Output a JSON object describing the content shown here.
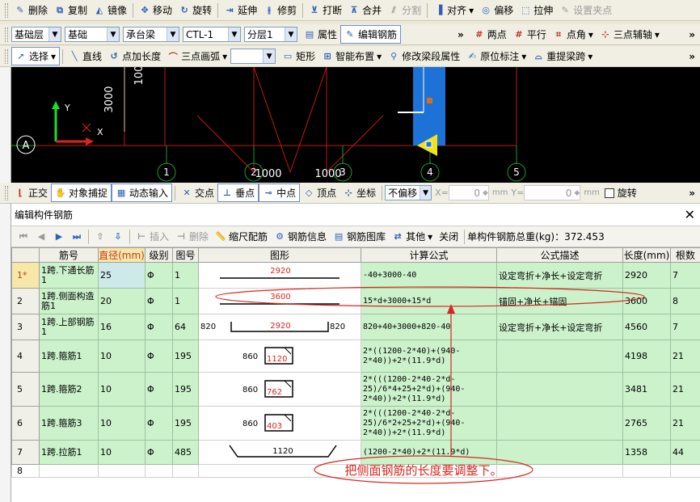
{
  "toolbar1": {
    "items": [
      {
        "label": "删除",
        "icon": "erase-icon",
        "disabled": false
      },
      {
        "label": "复制",
        "icon": "copy-icon",
        "disabled": false
      },
      {
        "label": "镜像",
        "icon": "mirror-icon",
        "disabled": false
      },
      {
        "label": "移动",
        "icon": "move-icon",
        "disabled": false
      },
      {
        "label": "旋转",
        "icon": "rotate-icon",
        "disabled": false
      },
      {
        "label": "延伸",
        "icon": "extend-icon",
        "disabled": false
      },
      {
        "label": "修剪",
        "icon": "trim-icon",
        "disabled": false
      },
      {
        "label": "打断",
        "icon": "break-icon",
        "disabled": false
      },
      {
        "label": "合并",
        "icon": "merge-icon",
        "disabled": false
      },
      {
        "label": "分割",
        "icon": "split-icon",
        "disabled": true
      },
      {
        "label": "对齐",
        "icon": "align-icon",
        "disabled": false
      },
      {
        "label": "偏移",
        "icon": "offset-icon",
        "disabled": false
      },
      {
        "label": "拉伸",
        "icon": "stretch-icon",
        "disabled": false
      },
      {
        "label": "设置夹点",
        "icon": "grip-point-icon",
        "disabled": true
      }
    ]
  },
  "toolbar2": {
    "floor": "基础层",
    "category": "基础",
    "type": "承台梁",
    "element": "CTL-1",
    "layer": "分层1",
    "props_label": "属性",
    "edit_rebar_label": "编辑钢筋",
    "right": [
      "两点",
      "平行",
      "点角",
      "三点辅轴"
    ]
  },
  "toolbar3": {
    "select_label": "选择",
    "items": [
      "直线",
      "点加长度",
      "三点画弧",
      "矩形",
      "智能布置",
      "修改梁段属性",
      "原位标注",
      "重提梁跨"
    ]
  },
  "cad": {
    "axis_label_a": "A",
    "dim_3000": "3000",
    "dim_100": "100",
    "dim_1000a": "1000",
    "dim_1000b": "1000",
    "grid_labels": [
      "1",
      "2",
      "3",
      "4",
      "5"
    ],
    "axis_y": "Y",
    "axis_x": "X"
  },
  "snapbar": {
    "items": [
      "正交",
      "对象捕捉",
      "动态输入",
      "交点",
      "垂点",
      "中点",
      "顶点",
      "坐标"
    ],
    "offset_mode": "不偏移",
    "x_label": "X=",
    "x_value": "0",
    "y_label": "Y=",
    "y_value": "0",
    "unit": "mm",
    "rotate_label": "旋转"
  },
  "panel": {
    "title": "编辑构件钢筋",
    "tools": [
      "插入",
      "删除",
      "缩尺配筋",
      "钢筋信息",
      "钢筋图库",
      "其他",
      "关闭"
    ],
    "total_label": "单构件钢筋总重(kg)：",
    "total_value": "372.453"
  },
  "table": {
    "headers": [
      "筋号",
      "直径(mm)",
      "级别",
      "图号",
      "图形",
      "计算公式",
      "公式描述",
      "长度(mm)",
      "根数"
    ],
    "rows": [
      {
        "num": "1*",
        "name": "1跨.下通长筋1",
        "dia": "25",
        "grade": "Φ",
        "fig_no": "1",
        "fig_left": "",
        "fig_mid": "2920",
        "fig_right": "",
        "formula": "-40+3000-40",
        "desc": "设定弯折+净长+设定弯折",
        "len": "2920",
        "count": "7"
      },
      {
        "num": "2",
        "name": "1跨.侧面构造筋1",
        "dia": "20",
        "grade": "Φ",
        "fig_no": "1",
        "fig_left": "",
        "fig_mid": "3600",
        "fig_right": "",
        "formula": "15*d+3000+15*d",
        "desc": "锚固+净长+锚固",
        "len": "3600",
        "count": "8"
      },
      {
        "num": "3",
        "name": "1跨.上部钢筋1",
        "dia": "16",
        "grade": "Φ",
        "fig_no": "64",
        "fig_left": "820",
        "fig_mid": "2920",
        "fig_right": "820",
        "formula": "820+40+3000+820-40",
        "desc": "设定弯折+净长+设定弯折",
        "len": "4560",
        "count": "7"
      },
      {
        "num": "4",
        "name": "1跨.箍筋1",
        "dia": "10",
        "grade": "Φ",
        "fig_no": "195",
        "fig_left": "860",
        "fig_mid": "1120",
        "fig_right": "",
        "formula": "2*((1200-2*40)+(940-2*40))+2*(11.9*d)",
        "desc": "",
        "len": "4198",
        "count": "21"
      },
      {
        "num": "5",
        "name": "1跨.箍筋2",
        "dia": "10",
        "grade": "Φ",
        "fig_no": "195",
        "fig_left": "860",
        "fig_mid": "762",
        "fig_right": "",
        "formula": "2*(((1200-2*40-2*d-25)/6*4+25+2*d)+(940-2*40))+2*(11.9*d)",
        "desc": "",
        "len": "3481",
        "count": "21"
      },
      {
        "num": "6",
        "name": "1跨.箍筋3",
        "dia": "10",
        "grade": "Φ",
        "fig_no": "195",
        "fig_left": "860",
        "fig_mid": "403",
        "fig_right": "",
        "formula": "2*(((1200-2*40-2*d-25)/6*2+25+2*d)+(940-2*40))+2*(11.9*d)",
        "desc": "",
        "len": "2765",
        "count": "21"
      },
      {
        "num": "7",
        "name": "1跨.拉筋1",
        "dia": "10",
        "grade": "Φ",
        "fig_no": "485",
        "fig_left": "",
        "fig_mid": "1120",
        "fig_right": "",
        "formula": "(1200-2*40)+2*(11.9*d)",
        "desc": "",
        "len": "1358",
        "count": "44"
      },
      {
        "num": "8",
        "name": "",
        "dia": "",
        "grade": "",
        "fig_no": "",
        "fig_left": "",
        "fig_mid": "",
        "fig_right": "",
        "formula": "",
        "desc": "",
        "len": "",
        "count": ""
      }
    ]
  },
  "annotation": {
    "text": "把侧面钢筋的长度要调整下。",
    "color": "#d8261e"
  }
}
